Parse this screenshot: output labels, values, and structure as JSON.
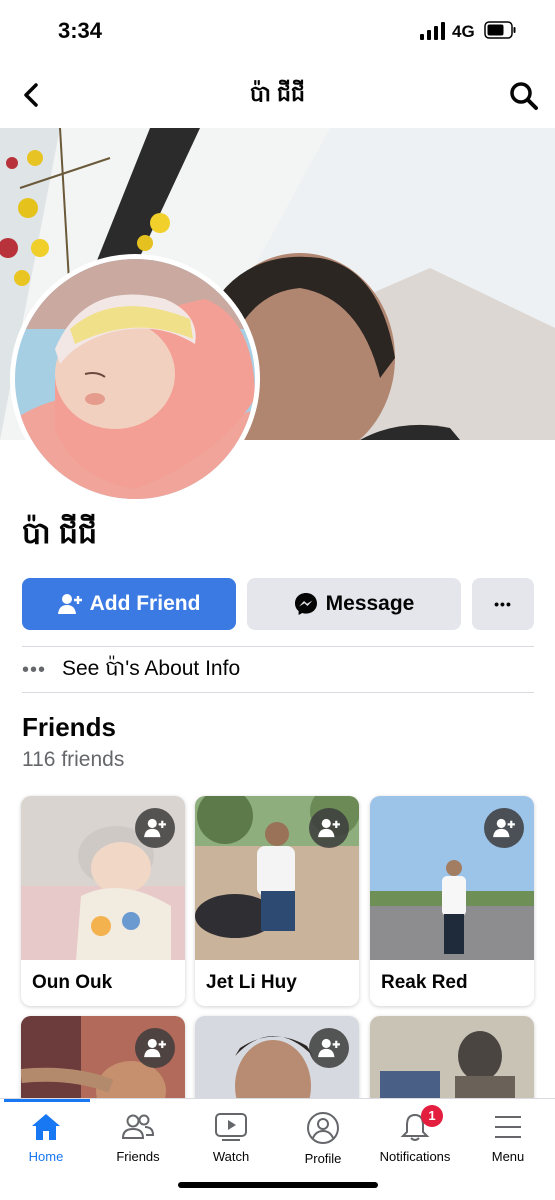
{
  "status_bar": {
    "time": "3:34",
    "network": "4G"
  },
  "nav": {
    "title": "ប៉ា ជីជី"
  },
  "profile": {
    "name": "ប៉ា ជីជី"
  },
  "actions": {
    "add_friend": "Add Friend",
    "message": "Message",
    "more": "•••"
  },
  "about": {
    "dots": "•••",
    "text": "See ប៉ា's About Info"
  },
  "friends": {
    "title": "Friends",
    "count": "116 friends",
    "items": [
      {
        "name": "Oun Ouk"
      },
      {
        "name": "Jet Li Huy"
      },
      {
        "name": "Reak Red"
      },
      {
        "name": ""
      },
      {
        "name": ""
      },
      {
        "name": ""
      }
    ]
  },
  "tabs": [
    {
      "label": "Home",
      "icon": "home-icon"
    },
    {
      "label": "Friends",
      "icon": "friends-icon"
    },
    {
      "label": "Watch",
      "icon": "watch-icon"
    },
    {
      "label": "Profile",
      "icon": "profile-icon"
    },
    {
      "label": "Notifications",
      "icon": "bell-icon",
      "badge": "1"
    },
    {
      "label": "Menu",
      "icon": "menu-icon"
    }
  ],
  "colors": {
    "primary": "#3b7ae3",
    "active_tab": "#1877f2",
    "badge": "#e41e3f",
    "secondary_button": "#e4e6eb"
  }
}
